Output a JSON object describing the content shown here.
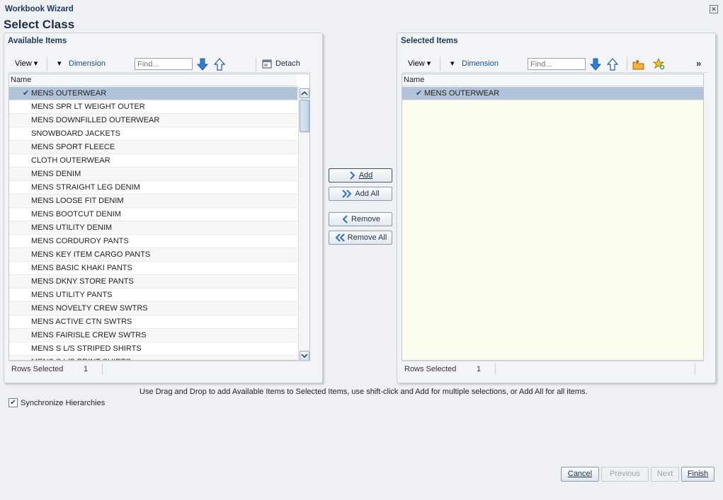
{
  "window": {
    "title": "Workbook Wizard",
    "close_glyph": "✕"
  },
  "page": {
    "heading": "Select Class"
  },
  "available": {
    "title": "Available Items",
    "toolbar": {
      "view": "View",
      "dimension": "Dimension",
      "find_placeholder": "Find...",
      "detach": "Detach"
    },
    "column": "Name",
    "rows": [
      "MENS OUTERWEAR",
      "MENS SPR LT WEIGHT OUTER",
      "MENS DOWNFILLED OUTERWEAR",
      "SNOWBOARD JACKETS",
      "MENS SPORT FLEECE",
      "CLOTH OUTERWEAR",
      "MENS DENIM",
      "MENS STRAIGHT LEG DENIM",
      "MENS LOOSE FIT DENIM",
      "MENS BOOTCUT DENIM",
      "MENS UTILITY DENIM",
      "MENS CORDUROY PANTS",
      "MENS KEY ITEM CARGO PANTS",
      "MENS BASIC KHAKI PANTS",
      "MENS DKNY STORE PANTS",
      "MENS UTILITY PANTS",
      "MENS NOVELTY CREW SWTRS",
      "MENS ACTIVE CTN SWTRS",
      "MENS FAIRISLE CREW SWTRS",
      "MENS S L/S STRIPED SHIRTS",
      "MENS S L/S PRINT SHIRTS"
    ],
    "status": {
      "label": "Rows Selected",
      "count": "1"
    }
  },
  "selected": {
    "title": "Selected Items",
    "toolbar": {
      "view": "View",
      "dimension": "Dimension",
      "find_placeholder": "Find...",
      "overflow": "»"
    },
    "column": "Name",
    "rows": [
      "MENS OUTERWEAR"
    ],
    "status": {
      "label": "Rows Selected",
      "count": "1"
    }
  },
  "shuttle": {
    "add": "Add",
    "add_all": "Add All",
    "remove": "Remove",
    "remove_all": "Remove All"
  },
  "hint": "Use Drag and Drop to add Available Items to Selected Items, use shift-click and Add for multiple selections, or Add All for all items.",
  "sync": {
    "label": "Synchronize Hierarchies",
    "checked": true
  },
  "footer": {
    "cancel": "Cancel",
    "previous": "Previous",
    "next": "Next",
    "finish": "Finish"
  },
  "colors": {
    "selected_row": "#b1c3d8",
    "link": "#1b4f8d",
    "selected_pane_bg": "#fdfdf2"
  }
}
